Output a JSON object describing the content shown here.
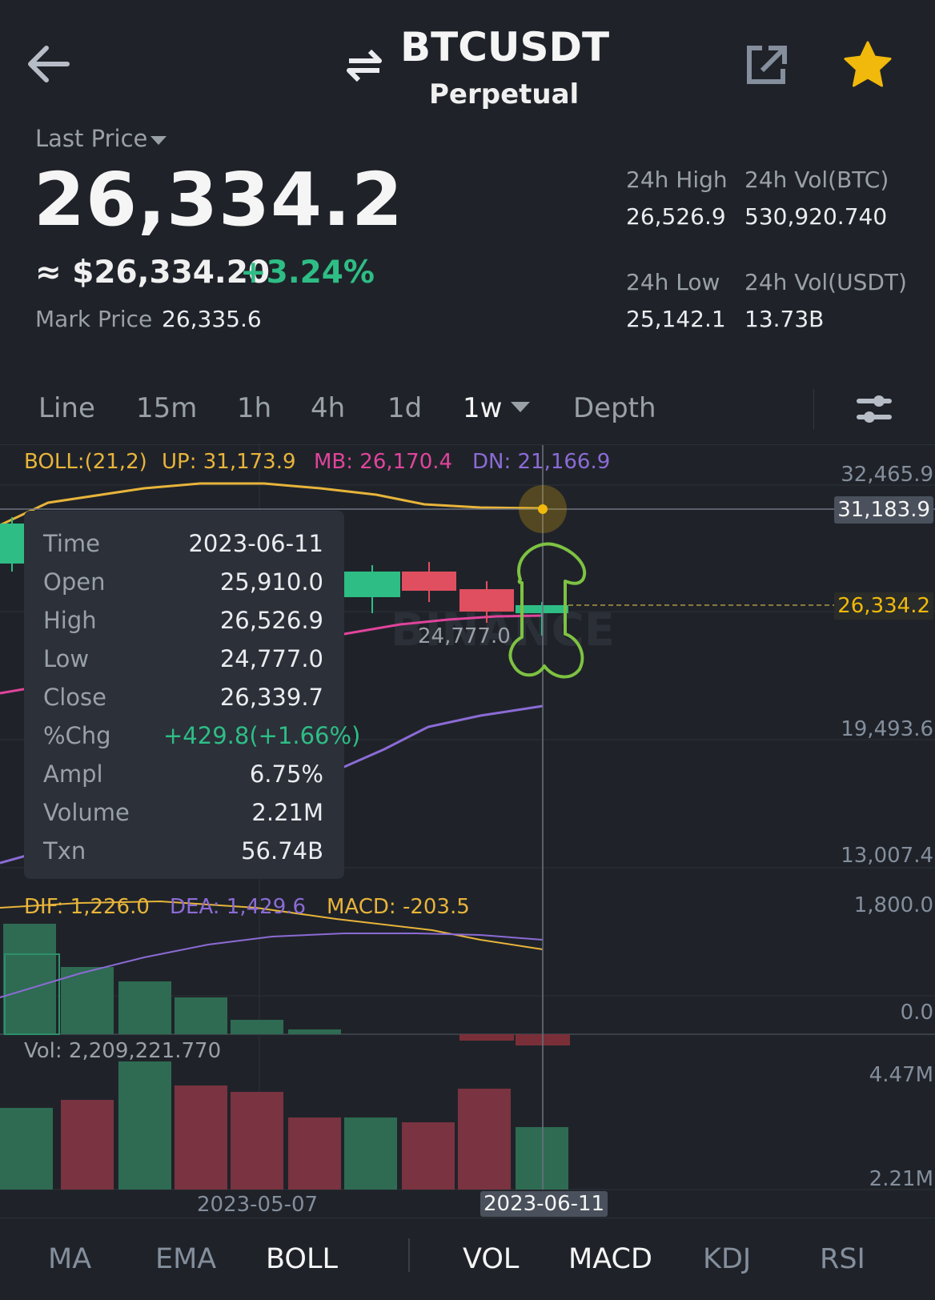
{
  "header": {
    "pair": "BTCUSDT",
    "contract": "Perpetual"
  },
  "price": {
    "label": "Last Price",
    "last": "26,334.2",
    "approx": "≈ $26,334.20",
    "change": "+3.24%",
    "mark_label": "Mark Price",
    "mark_value": "26,335.6"
  },
  "stats": {
    "high_label": "24h High",
    "high_value": "26,526.9",
    "vol_btc_label": "24h Vol(BTC)",
    "vol_btc_value": "530,920.740",
    "low_label": "24h Low",
    "low_value": "25,142.1",
    "vol_usdt_label": "24h Vol(USDT)",
    "vol_usdt_value": "13.73B"
  },
  "tabs": [
    "Line",
    "15m",
    "1h",
    "4h",
    "1d",
    "1w",
    "Depth"
  ],
  "active_tab": "1w",
  "indicators": {
    "boll": "BOLL:(21,2)",
    "up": "UP: 31,173.9",
    "mb": "MB: 26,170.4",
    "dn": "DN: 21,166.9",
    "dif": "DIF: 1,226.0",
    "dea": "DEA: 1,429.6",
    "macd": "MACD: -203.5",
    "vol": "Vol: 2,209,221.770"
  },
  "axis": {
    "price_ticks": [
      "32,465.9",
      "19,493.6",
      "13,007.4"
    ],
    "crosshair_price": "31,183.9",
    "last_price_tag": "26,334.2",
    "macd_ticks": [
      "1,800.0",
      "0.0"
    ],
    "vol_ticks": [
      "4.47M",
      "2.21M"
    ],
    "dates": [
      "2023-05-07"
    ],
    "crosshair_date": "2023-06-11",
    "low_marker": "24,777.0"
  },
  "tooltip": {
    "rows": [
      {
        "k": "Time",
        "v": "2023-06-11"
      },
      {
        "k": "Open",
        "v": "25,910.0"
      },
      {
        "k": "High",
        "v": "26,526.9"
      },
      {
        "k": "Low",
        "v": "24,777.0"
      },
      {
        "k": "Close",
        "v": "26,339.7"
      },
      {
        "k": "%Chg",
        "v": "+429.8(+1.66%)"
      },
      {
        "k": "Ampl",
        "v": "6.75%"
      },
      {
        "k": "Volume",
        "v": "2.21M"
      },
      {
        "k": "Txn",
        "v": "56.74B"
      }
    ]
  },
  "bottom_tabs": {
    "main": [
      "MA",
      "EMA",
      "BOLL"
    ],
    "sub": [
      "VOL",
      "MACD",
      "KDJ",
      "RSI"
    ]
  },
  "watermark": "BINANCE",
  "colors": {
    "background": "#1f2329",
    "up": "#2ebd85",
    "down": "#e04f5f",
    "boll_up": "#e8b43a",
    "boll_mb": "#e0449c",
    "boll_dn": "#8c6bd6",
    "accent": "#f0b90b",
    "doodle": "#7ec242"
  }
}
